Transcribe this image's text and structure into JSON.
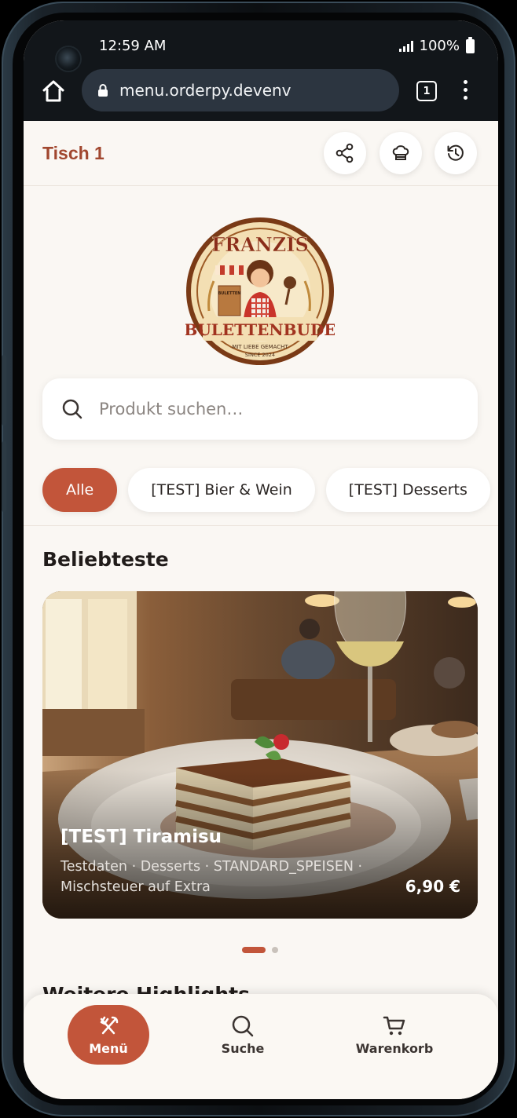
{
  "status": {
    "time": "12:59 AM",
    "battery": "100%"
  },
  "browser": {
    "url": "menu.orderpy.devenv",
    "tab_count": "1"
  },
  "header": {
    "table": "Tisch 1",
    "buttons": [
      "share-icon",
      "chef-hat-icon",
      "history-icon"
    ]
  },
  "logo": {
    "top_text": "FRANZIS",
    "name": "BULETTENBUDE",
    "tagline": "MIT LIEBE GEMACHT",
    "since": "SINCE 2024",
    "stall_sign": "BULETTEN"
  },
  "search": {
    "placeholder": "Produkt suchen…"
  },
  "categories": [
    {
      "label": "Alle",
      "active": true
    },
    {
      "label": "[TEST] Bier & Wein",
      "active": false
    },
    {
      "label": "[TEST] Desserts",
      "active": false
    }
  ],
  "popular": {
    "title": "Beliebteste",
    "card": {
      "name": "[TEST] Tiramisu",
      "meta": "Testdaten · Desserts · STANDARD_SPEISEN · Mischsteuer auf Extra",
      "price": "6,90 €"
    },
    "pager": {
      "count": 2,
      "active": 1
    }
  },
  "next_section": {
    "title": "Weitere Highlights"
  },
  "nav": {
    "menu": "Menü",
    "search": "Suche",
    "cart": "Warenkorb"
  },
  "colors": {
    "accent": "#c2553a",
    "table_label": "#a1472f",
    "background": "#faf7f3"
  }
}
